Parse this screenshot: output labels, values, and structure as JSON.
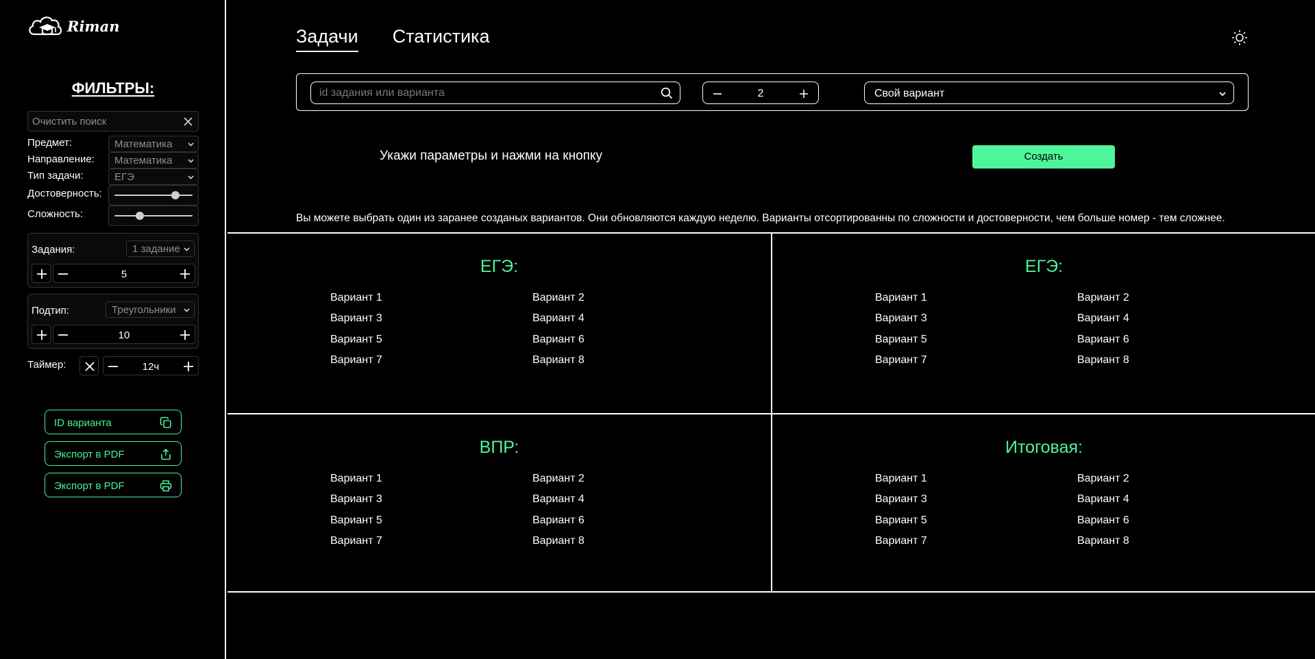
{
  "brand": {
    "name": "Riman"
  },
  "sidebar": {
    "filters_title": "ФИЛЬТРЫ:",
    "clear_search_placeholder": "Очистить поиск",
    "subject": {
      "label": "Предмет:",
      "value": "Математика"
    },
    "direction": {
      "label": "Направление:",
      "value": "Математика"
    },
    "task_type": {
      "label": "Тип задачи:",
      "value": "ЕГЭ"
    },
    "reliability": {
      "label": "Достоверность:",
      "level": 0.8
    },
    "difficulty": {
      "label": "Сложность:",
      "level": 0.3
    },
    "tasks_group": {
      "label": "Задания:",
      "select_value": "1 задание",
      "count": "5"
    },
    "subtype_group": {
      "label": "Подтип:",
      "select_value": "Треугольники",
      "count": "10"
    },
    "timer": {
      "label": "Таймер:",
      "value": "12ч"
    },
    "buttons": {
      "variant_id": "ID варианта",
      "export_pdf_1": "Экспорт в PDF",
      "export_pdf_2": "Экспорт в PDF"
    }
  },
  "main": {
    "tabs": [
      {
        "label": "Задачи",
        "active": true
      },
      {
        "label": "Статистика",
        "active": false
      }
    ],
    "search": {
      "placeholder": "id задания или варианта"
    },
    "count": "2",
    "variant_select": "Свой вариант",
    "hint": "Укажи параметры и нажми на кнопку",
    "create_button": "Создать",
    "info": "Вы можете выбрать один из заранее созданых вариантов. Они обновляются каждую неделю. Варианты отсортированны по сложности и достоверности, чем больше номер - тем сложнее.",
    "panels": [
      {
        "title": "ЕГЭ:",
        "variants": [
          "Вариант 1",
          "Вариант 2",
          "Вариант 3",
          "Вариант 4",
          "Вариант 5",
          "Вариант 6",
          "Вариант 7",
          "Вариант 8"
        ]
      },
      {
        "title": "ЕГЭ:",
        "variants": [
          "Вариант 1",
          "Вариант 2",
          "Вариант 3",
          "Вариант 4",
          "Вариант 5",
          "Вариант 6",
          "Вариант 7",
          "Вариант 8"
        ]
      },
      {
        "title": "ВПР:",
        "variants": [
          "Вариант 1",
          "Вариант 2",
          "Вариант 3",
          "Вариант 4",
          "Вариант 5",
          "Вариант 6",
          "Вариант 7",
          "Вариант 8"
        ]
      },
      {
        "title": "Итоговая:",
        "variants": [
          "Вариант 1",
          "Вариант 2",
          "Вариант 3",
          "Вариант 4",
          "Вариант 5",
          "Вариант 6",
          "Вариант 7",
          "Вариант 8"
        ]
      }
    ]
  },
  "colors": {
    "accent": "#4ef59a",
    "background": "#000000",
    "border": "#ffffff"
  }
}
